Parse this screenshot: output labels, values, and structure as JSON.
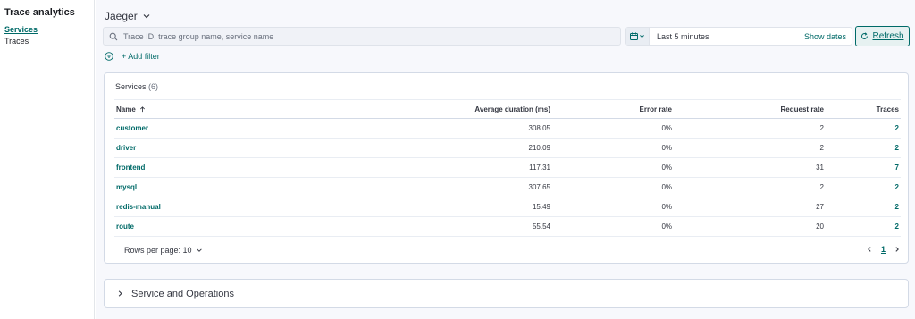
{
  "sidebar": {
    "title": "Trace analytics",
    "items": [
      {
        "label": "Services",
        "active": true
      },
      {
        "label": "Traces",
        "active": false
      }
    ]
  },
  "header": {
    "data_source": "Jaeger"
  },
  "search": {
    "placeholder": "Trace ID, trace group name, service name",
    "value": ""
  },
  "date_picker": {
    "range": "Last 5 minutes",
    "show_dates_label": "Show dates"
  },
  "refresh_label": "Refresh",
  "add_filter_label": "+ Add filter",
  "services_panel": {
    "title": "Services",
    "count": "(6)",
    "columns": {
      "name": "Name",
      "avg_duration": "Average duration (ms)",
      "error_rate": "Error rate",
      "request_rate": "Request rate",
      "traces": "Traces"
    },
    "rows": [
      {
        "name": "customer",
        "avg_duration": "308.05",
        "error_rate": "0%",
        "request_rate": "2",
        "traces": "2"
      },
      {
        "name": "driver",
        "avg_duration": "210.09",
        "error_rate": "0%",
        "request_rate": "2",
        "traces": "2"
      },
      {
        "name": "frontend",
        "avg_duration": "117.31",
        "error_rate": "0%",
        "request_rate": "31",
        "traces": "7"
      },
      {
        "name": "mysql",
        "avg_duration": "307.65",
        "error_rate": "0%",
        "request_rate": "2",
        "traces": "2"
      },
      {
        "name": "redis-manual",
        "avg_duration": "15.49",
        "error_rate": "0%",
        "request_rate": "27",
        "traces": "2"
      },
      {
        "name": "route",
        "avg_duration": "55.54",
        "error_rate": "0%",
        "request_rate": "20",
        "traces": "2"
      }
    ],
    "rows_per_page_label": "Rows per page: 10",
    "current_page": "1"
  },
  "accordion": {
    "title": "Service and Operations"
  },
  "colors": {
    "accent": "#006a68",
    "background": "#f7f8fc",
    "border": "#d3dae6"
  },
  "icons": [
    "chevron-down-icon",
    "search-icon",
    "calendar-icon",
    "refresh-icon",
    "filter-icon",
    "sort-up-arrow-icon",
    "chevron-left-icon",
    "chevron-right-icon"
  ]
}
